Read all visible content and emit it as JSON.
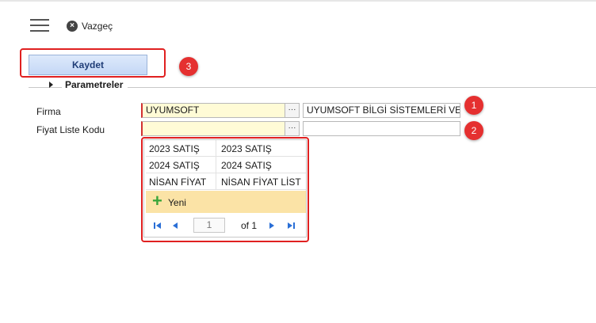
{
  "toolbar": {
    "cancel_label": "Vazgeç",
    "menu_icon": "hamburger-icon",
    "cancel_icon": "close-circle-icon"
  },
  "form": {
    "save_label": "Kaydet",
    "section_title": "Parametreler",
    "firma_label": "Firma",
    "firma_code": "UYUMSOFT",
    "firma_name": "UYUMSOFT BİLGİ SİSTEMLERİ VE T",
    "fiyat_label": "Fiyat Liste Kodu",
    "fiyat_code": "",
    "fiyat_name": "",
    "lookup_button": "···"
  },
  "dropdown": {
    "rows": [
      {
        "code": "2023 SATIŞ",
        "name": "2023 SATIŞ"
      },
      {
        "code": "2024 SATIŞ",
        "name": "2024 SATIŞ"
      },
      {
        "code": "NİSAN FİYAT",
        "name": "NİSAN FİYAT LİST"
      }
    ],
    "new_label": "Yeni",
    "page_number": "1",
    "page_of": "of 1"
  },
  "annotations": {
    "a1": "1",
    "a2": "2",
    "a3": "3"
  },
  "colors": {
    "required_border": "#d23030",
    "highlight": "#e02020",
    "new_row_bg": "#fbe3a6",
    "button_bg": "#c4d8f6"
  }
}
